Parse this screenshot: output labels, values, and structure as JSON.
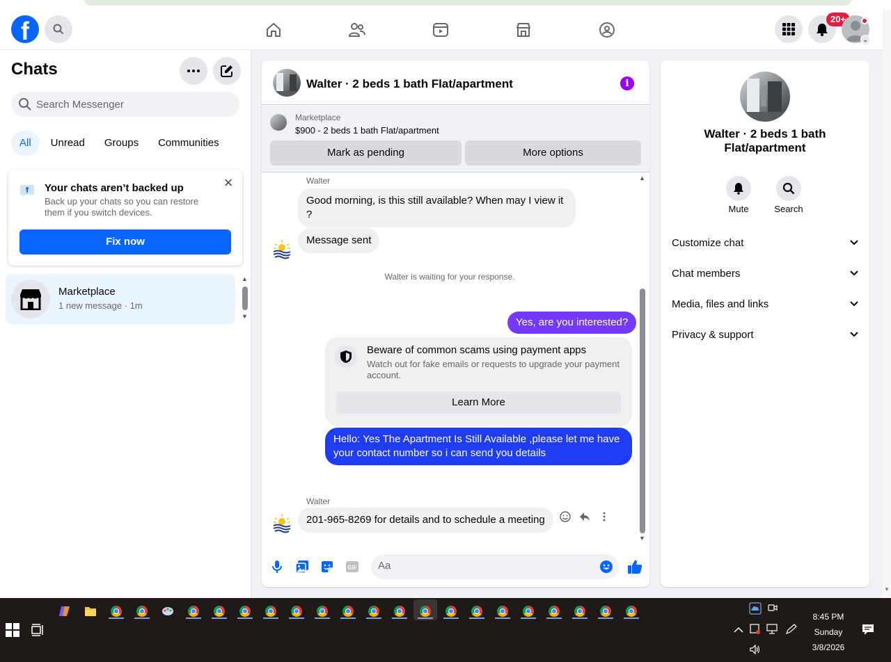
{
  "chats_panel": {
    "title": "Chats",
    "search_placeholder": "Search Messenger",
    "tabs": [
      "All",
      "Unread",
      "Groups",
      "Communities"
    ],
    "backup": {
      "title": "Your chats aren’t backed up",
      "text": "Back up your chats so you can restore them if you switch devices.",
      "button": "Fix now"
    },
    "items": [
      {
        "name": "Marketplace",
        "subtitle": "1 new message · 1m"
      }
    ]
  },
  "topbar": {
    "notification_badge": "20+"
  },
  "conversation": {
    "title": "Walter · 2 beds 1 bath Flat/apartment",
    "marketplace": {
      "label": "Marketplace",
      "listing": "$900 - 2 beds 1 bath Flat/apartment",
      "btn_pending": "Mark as pending",
      "btn_more": "More options"
    },
    "messages": {
      "sender1": "Walter",
      "msg1": "Good morning, is this still available?  When may I view it ?",
      "msg2": "Message sent",
      "waiting": "Walter is waiting for your response.",
      "out1": "Yes, are you interested?",
      "scam_title": "Beware of common scams using payment apps",
      "scam_text": "Watch out for fake emails or requests to upgrade your payment account.",
      "scam_button": "Learn More",
      "out2": "Hello: Yes The Apartment Is Still Available ,please let me have your contact number so i can send you details",
      "sender2": "Walter",
      "msg3": "201-965-8269 for details and to schedule a meeting"
    },
    "composer_placeholder": "Aa"
  },
  "details": {
    "title": "Walter · 2 beds 1 bath Flat/apartment",
    "actions": [
      "Mute",
      "Search"
    ],
    "sections": [
      "Customize chat",
      "Chat members",
      "Media, files and links",
      "Privacy & support"
    ]
  },
  "taskbar": {
    "time": "8:45 PM",
    "day": "Sunday",
    "date": "3/8/2026"
  },
  "colors": {
    "brand": "#0866ff",
    "outgoing_purple": "#7339ff",
    "outgoing_blue": "#1f3cf5",
    "info": "#9b00f5",
    "badge": "#e41e3f"
  }
}
